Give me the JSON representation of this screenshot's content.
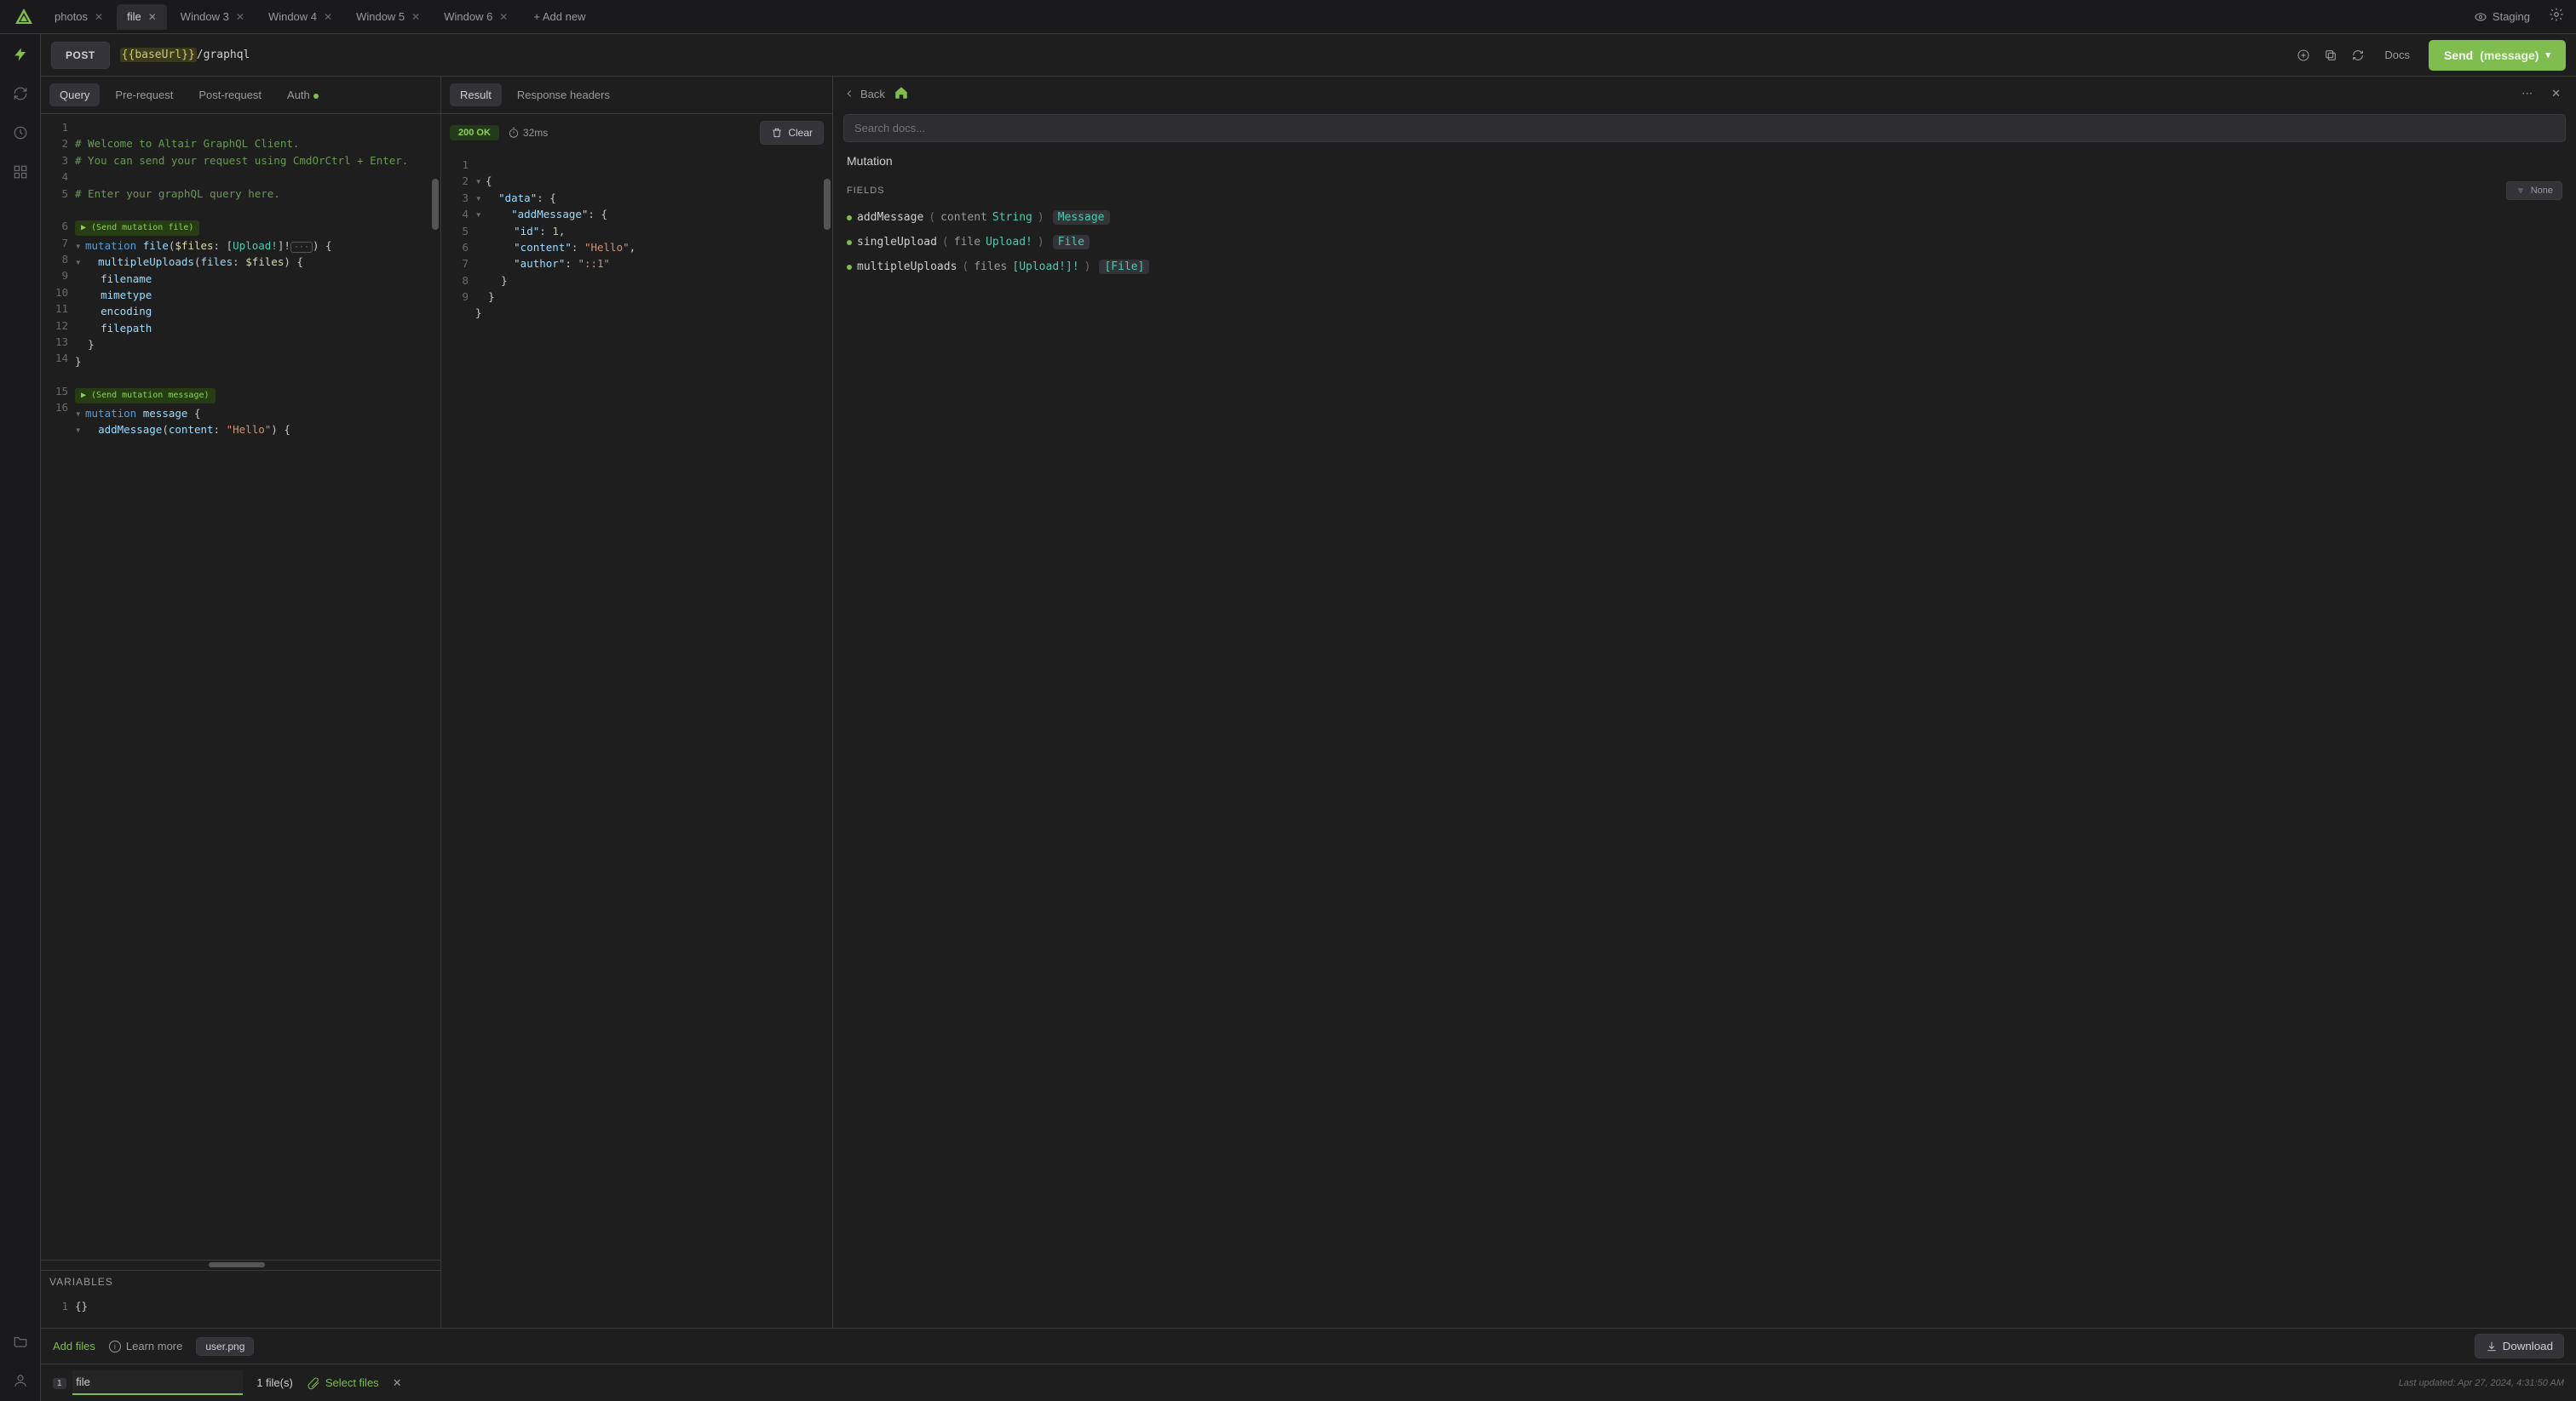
{
  "tabs": {
    "items": [
      {
        "label": "photos",
        "active": false
      },
      {
        "label": "file",
        "active": true
      },
      {
        "label": "Window 3",
        "active": false
      },
      {
        "label": "Window 4",
        "active": false
      },
      {
        "label": "Window 5",
        "active": false
      },
      {
        "label": "Window 6",
        "active": false
      }
    ],
    "add_label": "+ Add new",
    "staging_label": "Staging"
  },
  "urlbar": {
    "method": "POST",
    "url_template": "{{baseUrl}}",
    "url_suffix": "/graphql",
    "docs_label": "Docs",
    "send_label": "Send",
    "send_op": "(message)"
  },
  "query": {
    "tabs": {
      "query": "Query",
      "pre": "Pre-request",
      "post": "Post-request",
      "auth": "Auth"
    },
    "run_file_label": "▶ (Send mutation file)",
    "run_msg_label": "▶ (Send mutation message)",
    "comment1": "# Welcome to Altair GraphQL Client.",
    "comment2": "# You can send your request using CmdOrCtrl + Enter.",
    "comment3": "# Enter your graphQL query here.",
    "line6_mutation": "mutation",
    "line6_name": "file",
    "line6_var": "$files",
    "line6_type": "Upload!",
    "line7_field": "multipleUploads",
    "line7_arg": "files",
    "line7_var": "$files",
    "line8": "filename",
    "line9": "mimetype",
    "line10": "encoding",
    "line11": "filepath",
    "line15_mutation": "mutation",
    "line15_name": "message",
    "line16_field": "addMessage",
    "line16_arg": "content",
    "line16_val": "\"Hello\"",
    "variables_label": "VARIABLES",
    "variables_body": "{}"
  },
  "result": {
    "tabs": {
      "result": "Result",
      "headers": "Response headers"
    },
    "status": "200 OK",
    "time": "32ms",
    "clear_label": "Clear",
    "json": {
      "k_data": "\"data\"",
      "k_addMessage": "\"addMessage\"",
      "k_id": "\"id\"",
      "v_id": "1",
      "k_content": "\"content\"",
      "v_content": "\"Hello\"",
      "k_author": "\"author\"",
      "v_author": "\"::1\""
    }
  },
  "docs": {
    "back_label": "Back",
    "search_placeholder": "Search docs...",
    "crumb": "Mutation",
    "fields_label": "FIELDS",
    "sort_label": "None",
    "fields": [
      {
        "name": "addMessage",
        "arg_name": "content",
        "arg_type": "String",
        "ret": "Message"
      },
      {
        "name": "singleUpload",
        "arg_name": "file",
        "arg_type": "Upload!",
        "ret": "File"
      },
      {
        "name": "multipleUploads",
        "arg_name": "files",
        "arg_type": "[Upload!]!",
        "ret": "[File]"
      }
    ]
  },
  "footer": {
    "add_files": "Add files",
    "learn_more": "Learn more",
    "uploaded_chip": "user.png",
    "download": "Download",
    "var_name": "file",
    "file_count": "1 file(s)",
    "select_files": "Select files",
    "timestamp": "Last updated: Apr 27, 2024, 4:31:50 AM"
  }
}
